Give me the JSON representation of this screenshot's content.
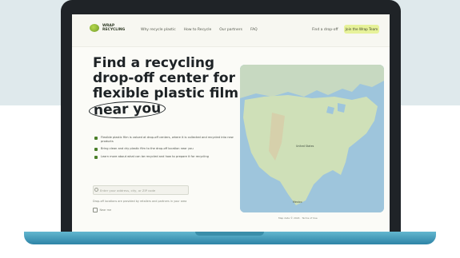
{
  "nav": {
    "logo_text": "WRAP RECYCLING",
    "links": [
      "Why recycle plastic",
      "How to Recycle",
      "Our partners",
      "FAQ"
    ],
    "find_link": "Find a drop-off",
    "cta": "Join the Wrap Team"
  },
  "hero": {
    "heading_lines": [
      "Find a recycling",
      "drop-off center for",
      "flexible plastic film"
    ],
    "heading_circled": "near you"
  },
  "bullets": [
    "Flexible plastic film is valued at drop-off centers, where it is collected and recycled into new products",
    "Bring clean and dry plastic film to the drop-off location near you",
    "Learn more about what can be recycled and how to prepare it for recycling"
  ],
  "search": {
    "placeholder": "Enter your address, city, or ZIP code"
  },
  "note": "Drop-off locations are provided by retailers and partners in your area",
  "checkbox_label": "Near me",
  "map": {
    "labels": [
      "United States",
      "Mexico"
    ],
    "footer": "Map data © 2024  ·  Terms of Use"
  },
  "colors": {
    "background_band": "#dfe9ec",
    "laptop_frame": "#1f2327",
    "screen": "#fbfbf7",
    "accent_green": "#4b7f2a",
    "cta_yellow": "#e7f29a",
    "laptop_base": "#3a9ebf",
    "map_water": "#9ec5dc",
    "map_land": "#cfe0b8"
  }
}
